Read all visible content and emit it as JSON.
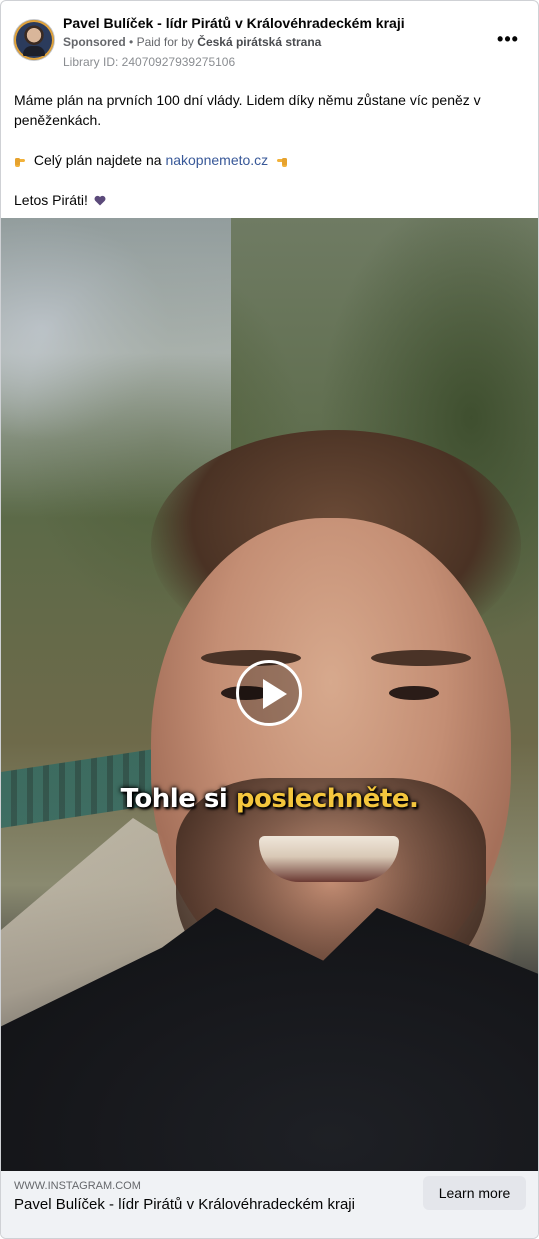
{
  "header": {
    "page_name": "Pavel Bulíček - lídr Pirátů v Královéhradeckém kraji",
    "sponsored": "Sponsored",
    "separator": "•",
    "paid_for_by_label": "Paid for by",
    "paid_for_by_name": "Česká pirátská strana",
    "library_id": "Library ID: 24070927939275106",
    "more_label": "•••"
  },
  "post": {
    "line1": "Máme plán na prvních 100 dní vlády. Lidem díky němu zůstane víc peněz v peněženkách.",
    "line2_prefix": "Celý plán najdete na",
    "line2_link": "nakopnemeto.cz",
    "line3": "Letos Piráti!"
  },
  "video": {
    "caption_white": "Tohle si",
    "caption_yellow": "poslechněte."
  },
  "footer": {
    "domain": "WWW.INSTAGRAM.COM",
    "title": "Pavel Bulíček - lídr Pirátů v Královéhradeckém kraji",
    "cta_label": "Learn more"
  },
  "colors": {
    "link": "#385898",
    "caption_highlight": "#f4c63d",
    "footer_bg": "#f0f2f5",
    "button_bg": "#e4e6eb"
  },
  "icons": [
    "more-options-icon",
    "pointing-right-emoji-icon",
    "pointing-left-emoji-icon",
    "purple-heart-icon",
    "play-icon"
  ]
}
